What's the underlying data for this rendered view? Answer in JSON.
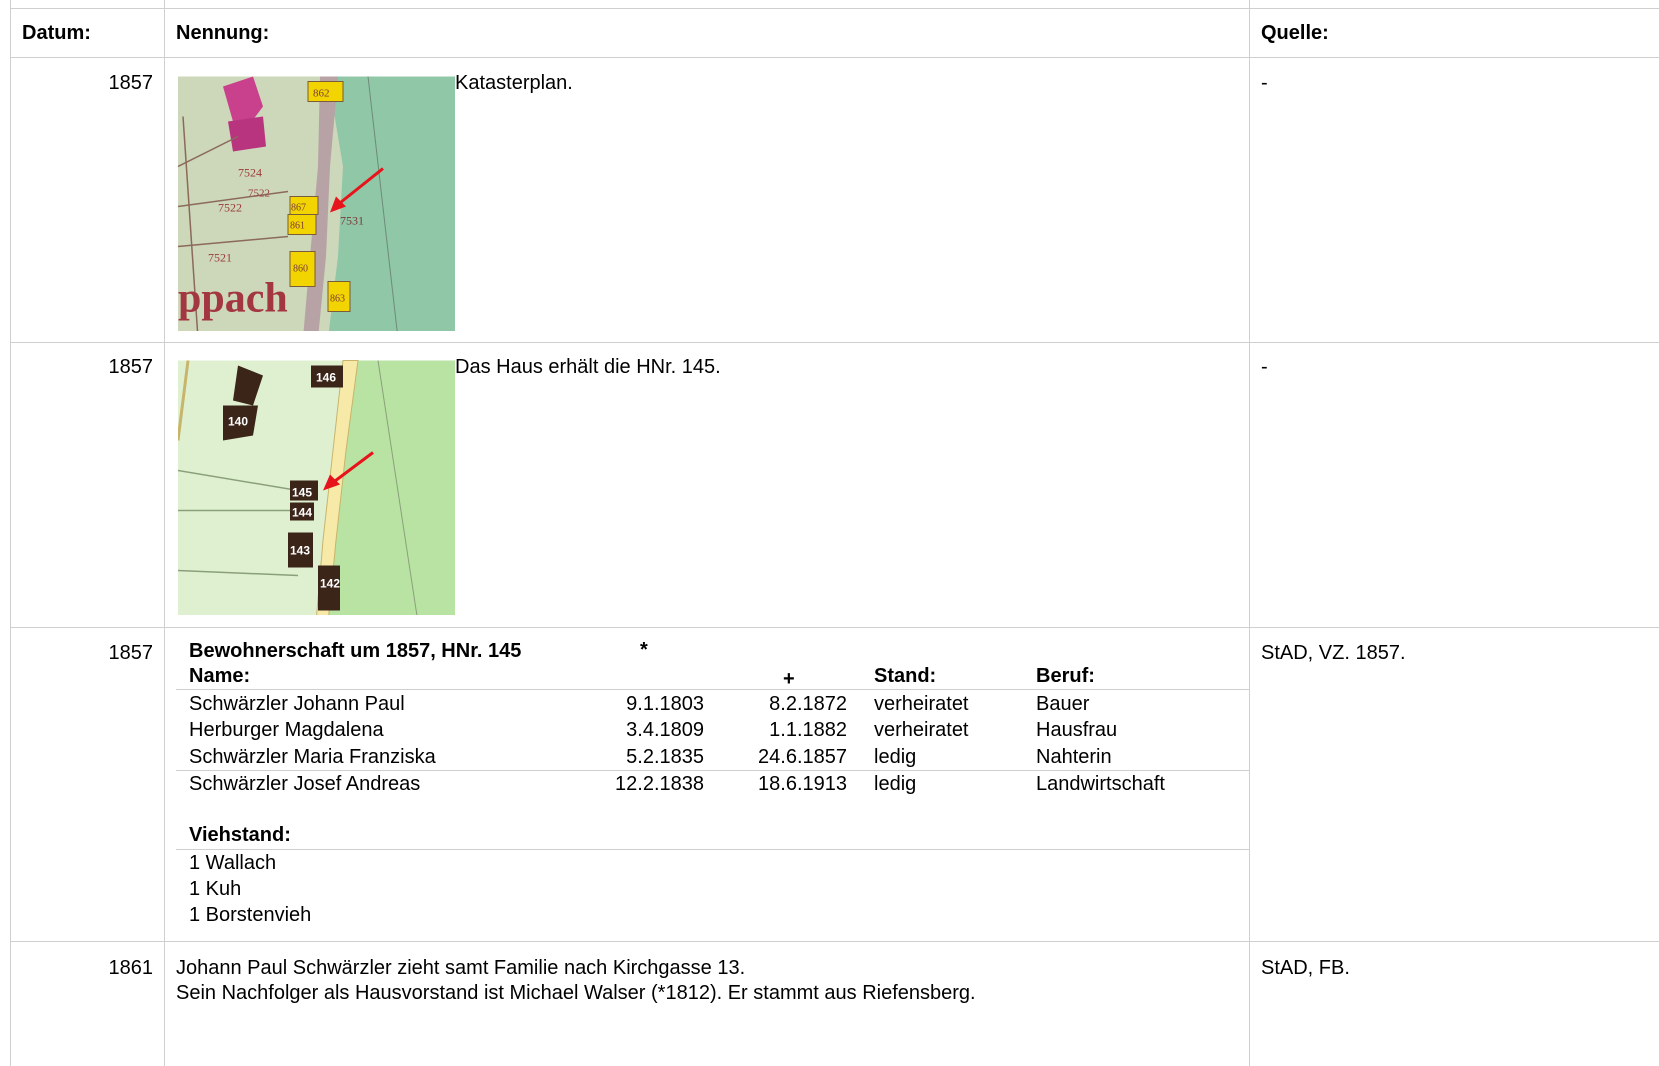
{
  "headers": {
    "datum": "Datum:",
    "nennung": "Nennung:",
    "quelle": "Quelle:"
  },
  "rows": [
    {
      "year": "1857",
      "text": "Katasterplan.",
      "source": "-",
      "map_labels": [
        "862",
        "7524",
        "7522",
        "7522",
        "867",
        "861",
        "7531",
        "7521",
        "860",
        "863",
        "ppach"
      ]
    },
    {
      "year": "1857",
      "text": "Das Haus erhält die HNr. 145.",
      "source": "-",
      "map_labels": [
        "146",
        "140",
        "145",
        "144",
        "143",
        "142"
      ]
    },
    {
      "year": "1857",
      "source": "StAD, VZ. 1857.",
      "census": {
        "title": "Bewohnerschaft um 1857, HNr. 145",
        "columns": [
          "Name:",
          "*",
          "+",
          "Stand:",
          "Beruf:"
        ],
        "persons": [
          [
            "Schwärzler Johann Paul",
            "9.1.1803",
            "8.2.1872",
            "verheiratet",
            "Bauer"
          ],
          [
            "Herburger Magdalena",
            "3.4.1809",
            "1.1.1882",
            "verheiratet",
            "Hausfrau"
          ],
          [
            "Schwärzler Maria Franziska",
            "5.2.1835",
            "24.6.1857",
            "ledig",
            "Nahterin"
          ],
          [
            "Schwärzler Josef Andreas",
            "12.2.1838",
            "18.6.1913",
            "ledig",
            "Landwirtschaft"
          ]
        ],
        "livestock_title": "Viehstand:",
        "livestock": [
          "1 Wallach",
          "1 Kuh",
          "1 Borstenvieh"
        ]
      }
    },
    {
      "year": "1861",
      "source": "StAD, FB.",
      "lines": [
        "Johann Paul Schwärzler zieht samt Familie nach Kirchgasse 13.",
        "Sein Nachfolger als Hausvorstand ist Michael Walser (*1812). Er stammt aus Riefensberg."
      ]
    }
  ],
  "colors": {
    "grid": "#cfcfcf",
    "arrow": "#e8141b",
    "house_old": "#f2d400",
    "house_new": "#3b2418",
    "map_old_bg": "#cdd7ba",
    "map_old_meadow": "#8fc7a7",
    "map_new_bg": "#dff0d0",
    "map_new_meadow": "#b8e3a3"
  }
}
